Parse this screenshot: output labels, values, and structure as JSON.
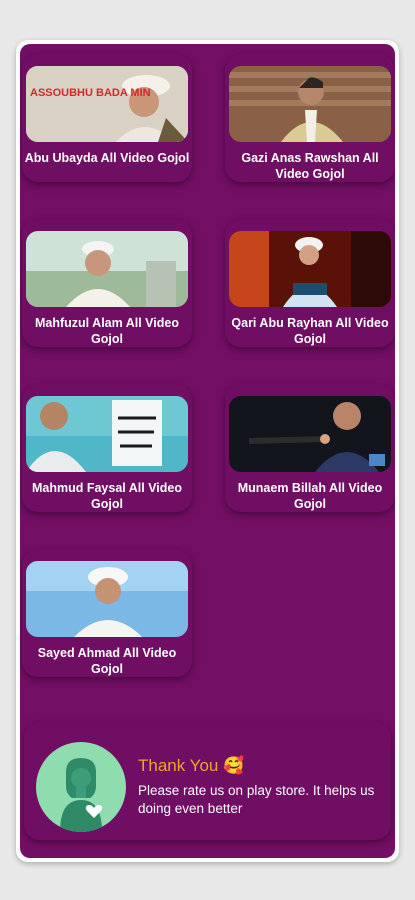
{
  "videos": [
    {
      "title": "Abu Ubayda All Video Gojol",
      "thumb_text": "ASSOUBHU BADA MIN"
    },
    {
      "title": "Gazi Anas Rawshan All Video Gojol"
    },
    {
      "title": "Mahfuzul Alam All Video Gojol"
    },
    {
      "title": "Qari Abu Rayhan All Video Gojol"
    },
    {
      "title": "Mahmud Faysal All Video Gojol"
    },
    {
      "title": "Munaem Billah All Video Gojol"
    },
    {
      "title": "Sayed Ahmad All Video Gojol"
    }
  ],
  "rate": {
    "title": "Thank You 🥰",
    "message": "Please rate us on play store. It helps us doing even better",
    "icon": "person-heart-icon"
  },
  "colors": {
    "panel": "#740f66",
    "accent": "#f0a32d",
    "icon_bg": "#8fdcae"
  }
}
